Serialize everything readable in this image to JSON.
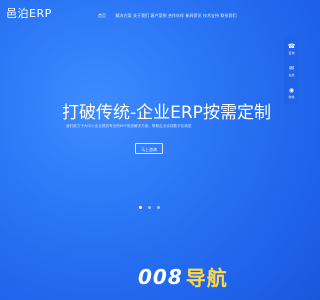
{
  "brand": {
    "logo_text": "邑泊ERP"
  },
  "nav": {
    "items": [
      {
        "label": "首页"
      },
      {
        "label": "解决方案"
      },
      {
        "label": "关于我们"
      },
      {
        "label": "客户案例"
      },
      {
        "label": "合作伙伴"
      },
      {
        "label": "新闻资讯"
      },
      {
        "label": "技术支持"
      },
      {
        "label": "联系我们"
      }
    ]
  },
  "hero": {
    "headline": "打破传统-企业ERP按需定制",
    "description": "我们致力于为中小企业提供专业的ERP系统解决方案，帮助企业实现数字化转型",
    "button_label": "马上咨询"
  },
  "carousel": {
    "slides": 3,
    "active_index": 0
  },
  "side_bar": {
    "items": [
      {
        "icon": "phone-icon",
        "glyph": "☎",
        "label": "咨询"
      },
      {
        "icon": "qq-icon",
        "glyph": "✉",
        "label": "在线"
      },
      {
        "icon": "wechat-icon",
        "glyph": "◉",
        "label": "微信"
      }
    ]
  },
  "watermark": {
    "number": "008",
    "text": "导航"
  }
}
